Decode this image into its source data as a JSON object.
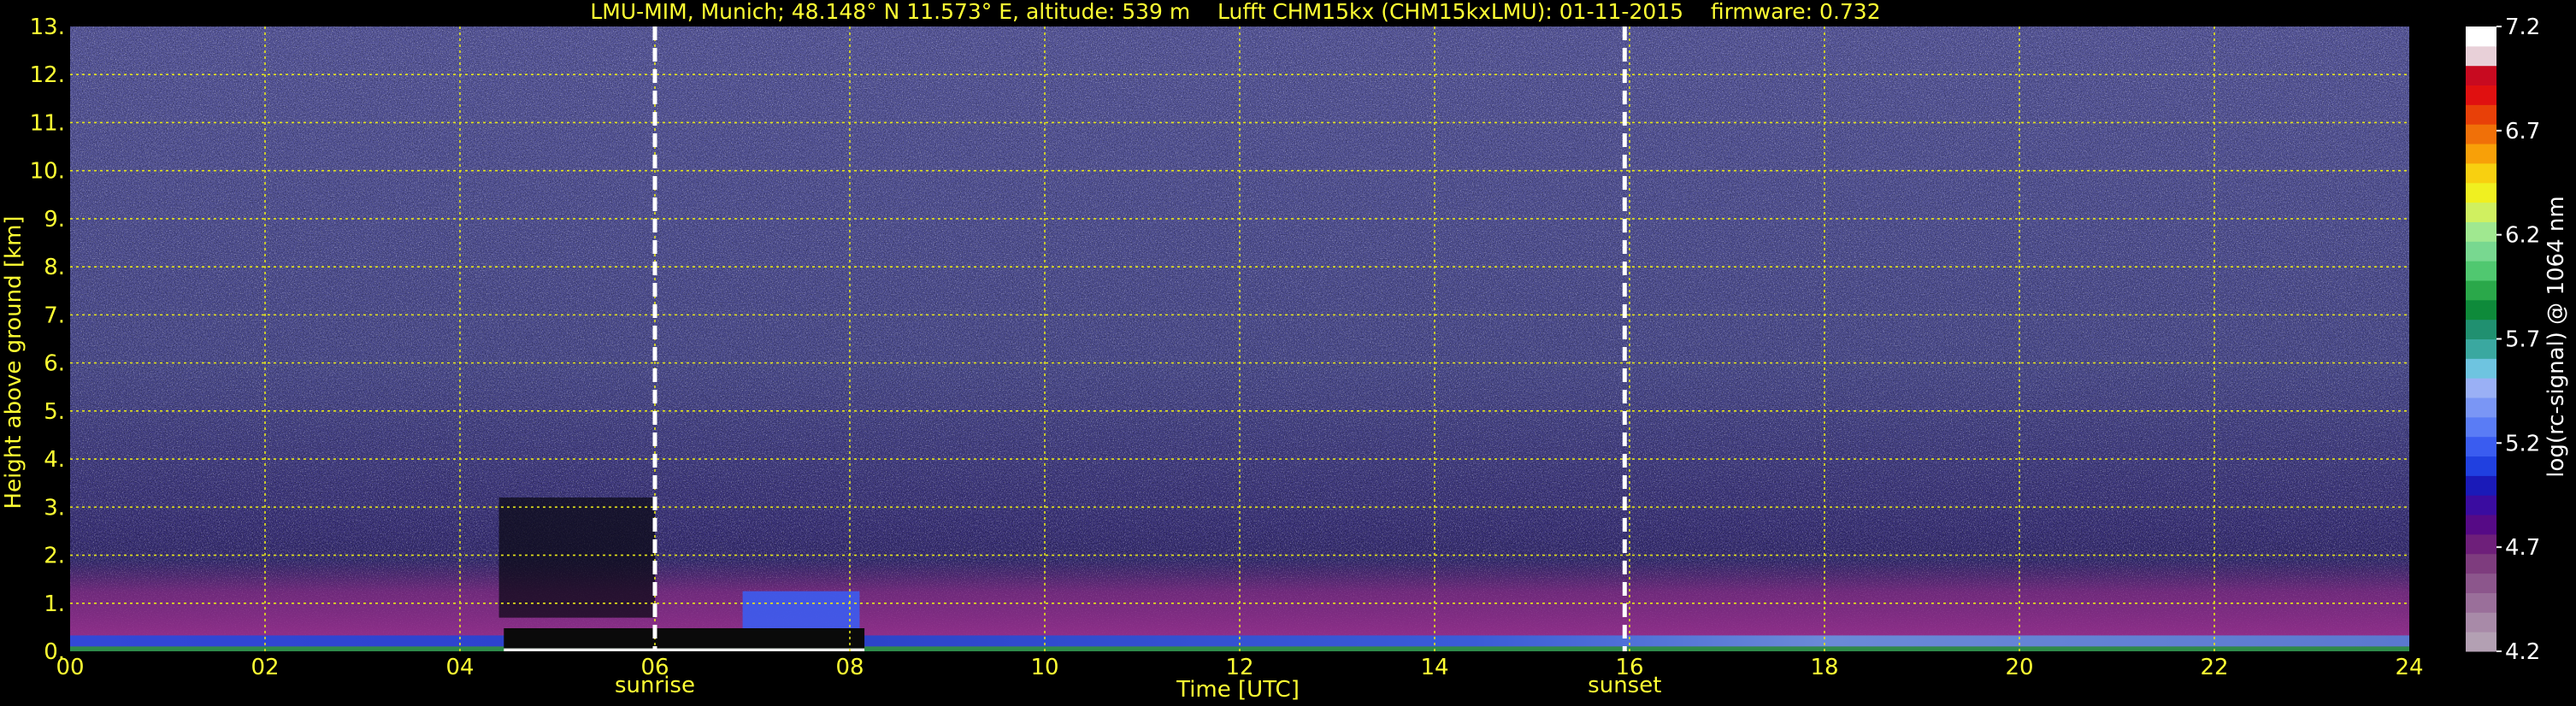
{
  "chart_data": {
    "type": "heatmap",
    "title": "LMU-MIM, Munich; 48.148° N 11.573° E, altitude: 539 m    Lufft CHM15kx (CHM15kxLMU): 01-11-2015    firmware: 0.732",
    "xlabel": "Time [UTC]",
    "ylabel": "Height above ground [km]",
    "x_range": [
      0,
      24
    ],
    "y_range": [
      0,
      13
    ],
    "x_ticks": [
      "00",
      "02",
      "04",
      "06",
      "08",
      "10",
      "12",
      "14",
      "16",
      "18",
      "20",
      "22",
      "24"
    ],
    "y_ticks": [
      "0.",
      "1.",
      "2.",
      "3.",
      "4.",
      "5.",
      "6.",
      "7.",
      "8.",
      "9.",
      "10.",
      "11.",
      "12.",
      "13."
    ],
    "grid": true,
    "markers": [
      {
        "label": "sunrise",
        "x": 6.0
      },
      {
        "label": "sunset",
        "x": 15.95
      }
    ],
    "colorbar": {
      "label": "log(rc-signal) @ 1064 nm",
      "range": [
        4.2,
        7.2
      ],
      "ticks": [
        "7.2",
        "6.7",
        "6.2",
        "5.7",
        "5.2",
        "4.7",
        "4.2"
      ],
      "colors": [
        "#b3a0b3",
        "#a88aa8",
        "#9a6f9a",
        "#8c568c",
        "#7e3c7e",
        "#6e1f7a",
        "#560a86",
        "#3a0ca0",
        "#1a1ab8",
        "#2040e0",
        "#3a5cf0",
        "#5a7cf5",
        "#7a96f5",
        "#9ab0f5",
        "#6ec4e0",
        "#3aa8a0",
        "#209070",
        "#0e8a3a",
        "#2aa84a",
        "#50c870",
        "#78d890",
        "#a0e890",
        "#d0f060",
        "#f0f020",
        "#f8d010",
        "#f8a008",
        "#f07008",
        "#e84008",
        "#e01010",
        "#c80a20",
        "#e8d0d8",
        "#ffffff"
      ]
    },
    "series": []
  }
}
